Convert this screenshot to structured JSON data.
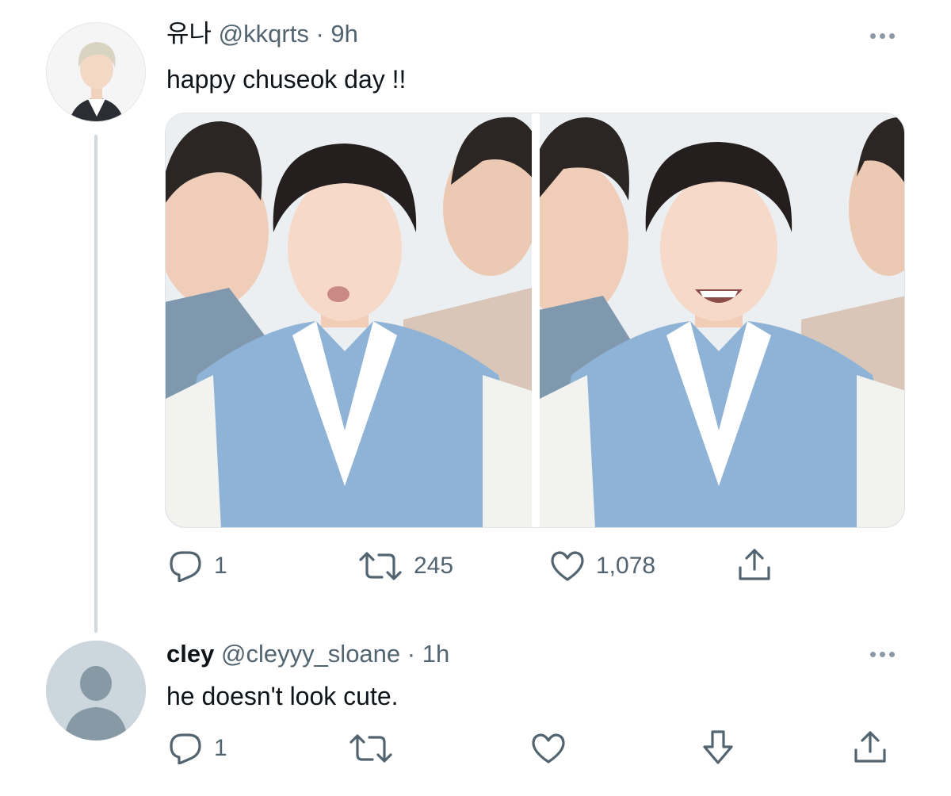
{
  "tweet": {
    "display_name": "유나",
    "handle": "@kkqrts",
    "separator": "·",
    "time": "9h",
    "text": "happy chuseok day !!",
    "media_alt": [
      "hanbok photo left",
      "hanbok photo right"
    ],
    "actions": {
      "reply_count": "1",
      "retweet_count": "245",
      "like_count": "1,078"
    }
  },
  "reply": {
    "display_name": "cley",
    "handle": "@cleyyy_sloane",
    "separator": "·",
    "time": "1h",
    "text": "he doesn't look cute.",
    "actions": {
      "reply_count": "1"
    }
  },
  "colors": {
    "text_primary": "#0f1419",
    "text_secondary": "#536471",
    "thread_line": "#cfd9de",
    "default_avatar_bg": "#ccd6dd",
    "default_avatar_fg": "#8899a6",
    "hanbok_blue": "#8fb3d6"
  },
  "icons": [
    "more-icon",
    "reply-icon",
    "retweet-icon",
    "like-icon",
    "share-icon",
    "downvote-icon"
  ]
}
